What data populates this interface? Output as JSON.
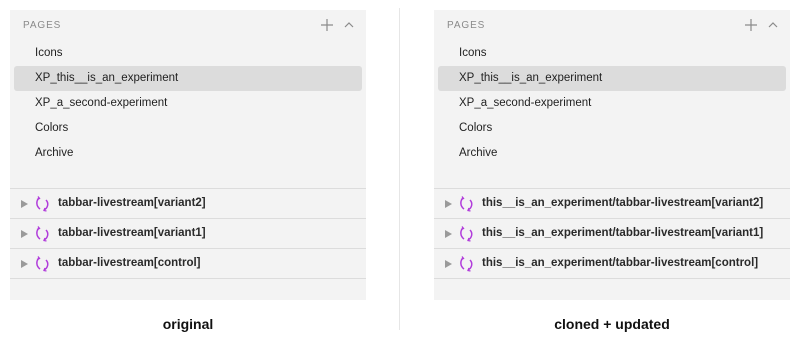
{
  "colors": {
    "panel_bg": "#f3f3f3",
    "selected_bg": "#dcdcdc",
    "symbol_accent": "#b13cdb",
    "muted": "#8a8a8a"
  },
  "left": {
    "header": {
      "title": "PAGES",
      "add_icon": "plus-icon",
      "collapse_icon": "chevron-up-icon"
    },
    "pages": [
      {
        "label": "Icons",
        "selected": false
      },
      {
        "label": "XP_this__is_an_experiment",
        "selected": true
      },
      {
        "label": "XP_a_second-experiment",
        "selected": false
      },
      {
        "label": "Colors",
        "selected": false
      },
      {
        "label": "Archive",
        "selected": false
      }
    ],
    "layers": [
      {
        "label": "tabbar-livestream[variant2]",
        "icon": "symbol-icon"
      },
      {
        "label": "tabbar-livestream[variant1]",
        "icon": "symbol-icon"
      },
      {
        "label": "tabbar-livestream[control]",
        "icon": "symbol-icon"
      }
    ],
    "caption": "original"
  },
  "right": {
    "header": {
      "title": "PAGES",
      "add_icon": "plus-icon",
      "collapse_icon": "chevron-up-icon"
    },
    "pages": [
      {
        "label": "Icons",
        "selected": false
      },
      {
        "label": "XP_this__is_an_experiment",
        "selected": true
      },
      {
        "label": "XP_a_second-experiment",
        "selected": false
      },
      {
        "label": "Colors",
        "selected": false
      },
      {
        "label": "Archive",
        "selected": false
      }
    ],
    "layers": [
      {
        "label": "this__is_an_experiment/tabbar-livestream[variant2]",
        "icon": "symbol-icon"
      },
      {
        "label": "this__is_an_experiment/tabbar-livestream[variant1]",
        "icon": "symbol-icon"
      },
      {
        "label": "this__is_an_experiment/tabbar-livestream[control]",
        "icon": "symbol-icon"
      }
    ],
    "caption": "cloned + updated"
  }
}
